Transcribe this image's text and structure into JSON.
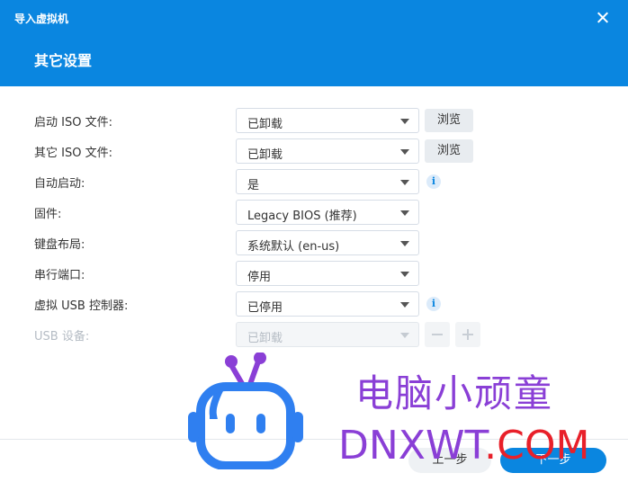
{
  "window": {
    "title": "导入虚拟机"
  },
  "page": {
    "title": "其它设置"
  },
  "fields": [
    {
      "label": "启动 ISO 文件:",
      "value": "已卸载",
      "button": "浏览"
    },
    {
      "label": "其它 ISO 文件:",
      "value": "已卸载",
      "button": "浏览"
    },
    {
      "label": "自动启动:",
      "value": "是"
    },
    {
      "label": "固件:",
      "value": "Legacy BIOS (推荐)"
    },
    {
      "label": "键盘布局:",
      "value": "系统默认 (en-us)"
    },
    {
      "label": "串行端口:",
      "value": "停用"
    },
    {
      "label": "虚拟 USB 控制器:",
      "value": "已停用"
    },
    {
      "label": "USB 设备:",
      "value": "已卸载"
    }
  ],
  "info_glyph": "i",
  "footer": {
    "prev": "上一步",
    "next": "下一步"
  },
  "watermark": {
    "line1": "电脑小顽童",
    "line2_a": "DNXWT",
    "line2_b": ".COM",
    "colors": {
      "purple": "#8a3fd6",
      "red": "#e8202a",
      "blue": "#2f7ff0"
    }
  },
  "colors": {
    "accent": "#0a86e0"
  },
  "icons": {
    "close": "close-icon",
    "dropdown": "chevron-down-icon",
    "info": "info-icon",
    "minus": "minus-icon",
    "plus": "plus-icon",
    "logo": "robot-logo-icon"
  }
}
